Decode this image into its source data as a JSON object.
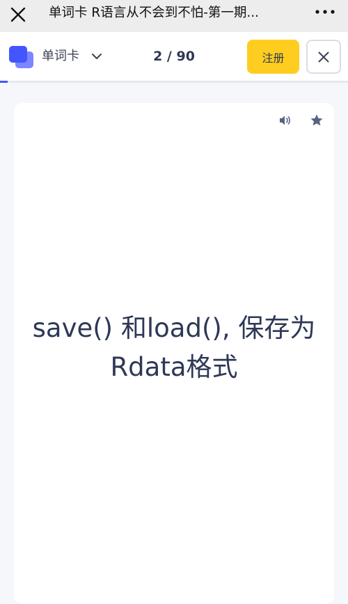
{
  "window": {
    "title": "单词卡 R语言从不会到不怕-第一期..."
  },
  "header": {
    "deck_label": "单词卡",
    "counter": "2 / 90",
    "register_label": "注册",
    "progress_fraction": 0.022
  },
  "card": {
    "term": "save() 和load(), 保存为Rdata格式"
  },
  "colors": {
    "accent": "#4255ff",
    "register_bg": "#ffcd1f",
    "text_dark": "#2e3856"
  }
}
